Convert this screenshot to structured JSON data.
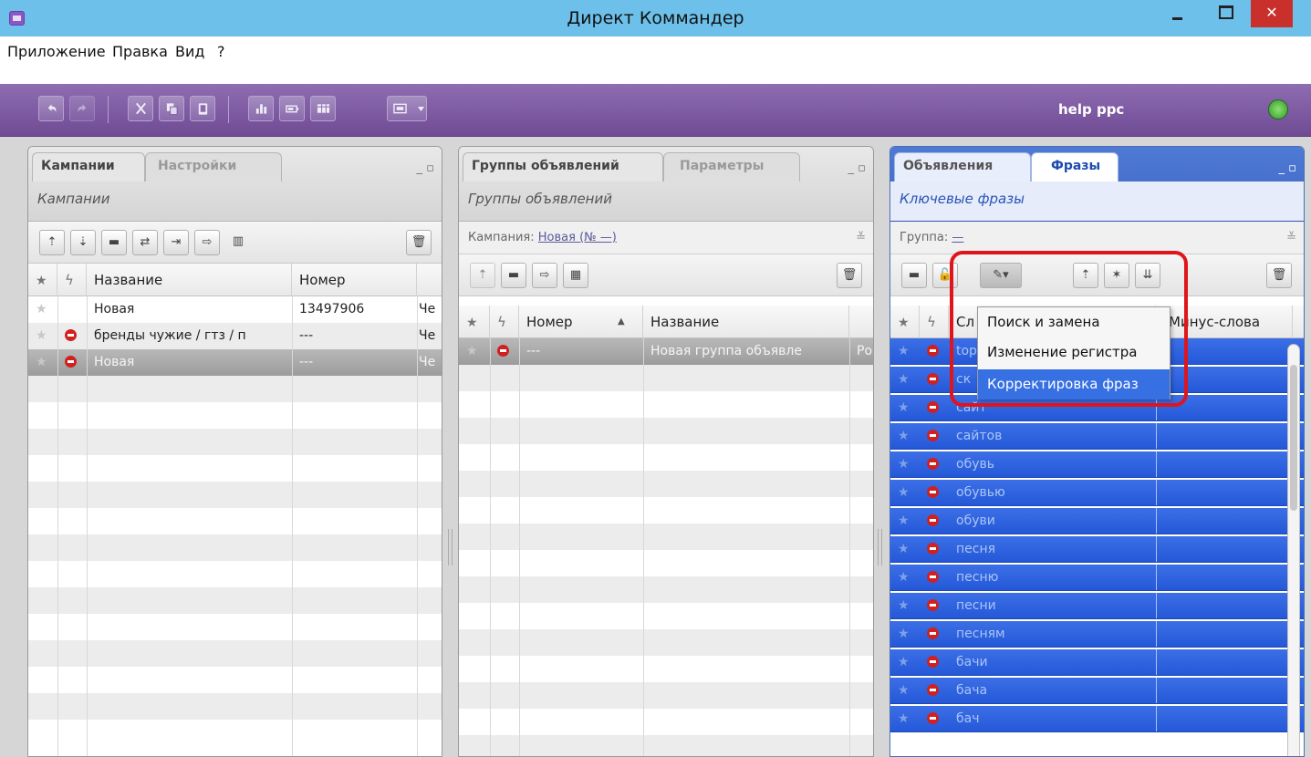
{
  "window": {
    "title": "Директ Коммандер",
    "close_glyph": "✕"
  },
  "menu": [
    "Приложение",
    "Правка",
    "Вид",
    "?"
  ],
  "toolbar": {
    "user": "help ppc"
  },
  "campaigns_panel": {
    "tabs": [
      "Кампании",
      "Настройки"
    ],
    "subtitle": "Кампании",
    "columns": [
      "Название",
      "Номер"
    ],
    "rows": [
      {
        "name": "Новая",
        "number": "13497906",
        "extra": "Че",
        "status": "none"
      },
      {
        "name": "бренды чужие / гтз / п",
        "number": "---",
        "extra": "Че",
        "status": "stop"
      },
      {
        "name": "Новая",
        "number": "---",
        "extra": "Че",
        "status": "stop",
        "selected": true
      }
    ]
  },
  "groups_panel": {
    "tabs": [
      "Группы объявлений",
      "Параметры"
    ],
    "subtitle": "Группы объявлений",
    "filter_label": "Кампания:",
    "filter_value": "Новая (№ —)",
    "columns": [
      "Номер",
      "Название"
    ],
    "sort_indicator": "▲",
    "rows": [
      {
        "number": "---",
        "name": "Новая группа объявле",
        "extra": "Ро",
        "status": "stop",
        "selected": true
      }
    ]
  },
  "phrases_panel": {
    "tabs": [
      "Объявления",
      "Фразы"
    ],
    "subtitle": "Ключевые фразы",
    "filter_label": "Группа:",
    "filter_value": "—",
    "columns": [
      "Сл",
      "Минус-слова"
    ],
    "rows": [
      "top",
      "ск",
      "сайт",
      "сайтов",
      "обувь",
      "обувью",
      "обуви",
      "песня",
      "песню",
      "песни",
      "песням",
      "бачи",
      "бача",
      "бач"
    ]
  },
  "dropdown": {
    "items": [
      "Поиск и замена",
      "Изменение регистра",
      "Корректировка фраз"
    ],
    "selected_index": 2
  }
}
